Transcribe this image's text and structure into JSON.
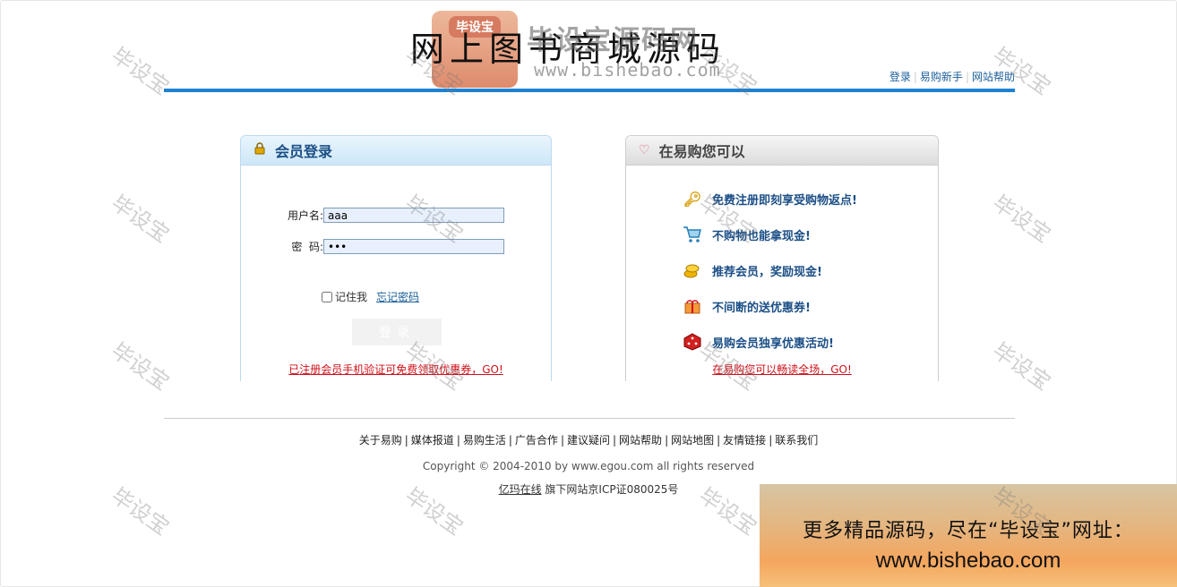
{
  "header": {
    "site_title": "网上图书商城源码",
    "logo_badge": "毕设宝",
    "logo_brand": "毕设宝源码网",
    "logo_url": "www.bishebao.com",
    "top_links": [
      "登录",
      "易购新手",
      "网站帮助"
    ]
  },
  "login_panel": {
    "title": "会员登录",
    "username_label": "用户名:",
    "username_value": "aaa",
    "password_label": "密  码:",
    "password_value": "aaa",
    "remember_label": "记住我",
    "forgot_link": "忘记密码",
    "submit_label": "登录",
    "promo_link": "已注册会员手机验证可免费领取优惠券，GO!"
  },
  "benefits_panel": {
    "title": "在易购您可以",
    "items": [
      {
        "icon": "key-icon",
        "text": "免费注册即刻享受购物返点!"
      },
      {
        "icon": "cart-icon",
        "text": "不购物也能拿现金!"
      },
      {
        "icon": "coins-icon",
        "text": "推荐会员，奖励现金!"
      },
      {
        "icon": "gift-icon",
        "text": "不间断的送优惠券!"
      },
      {
        "icon": "dice-icon",
        "text": "易购会员独享优惠活动!"
      }
    ],
    "bottom_link": "在易购您可以畅读全场，GO!"
  },
  "footer": {
    "links": [
      "关于易购",
      "媒体报道",
      "易购生活",
      "广告合作",
      "建议疑问",
      "网站帮助",
      "网站地图",
      "友情链接",
      "联系我们"
    ],
    "copyright": "Copyright © 2004-2010 by www.egou.com all rights reserved",
    "icp_link": "亿玛在线",
    "icp_text": " 旗下网站京ICP证080025号"
  },
  "watermark_text": "毕设宝",
  "ad_banner": {
    "line1": "更多精品源码，尽在“毕设宝”网址：",
    "line2": "www.bishebao.com"
  },
  "colors": {
    "accent_blue": "#1e82d2",
    "link_blue": "#1b4f86",
    "promo_red": "#d0101a"
  }
}
